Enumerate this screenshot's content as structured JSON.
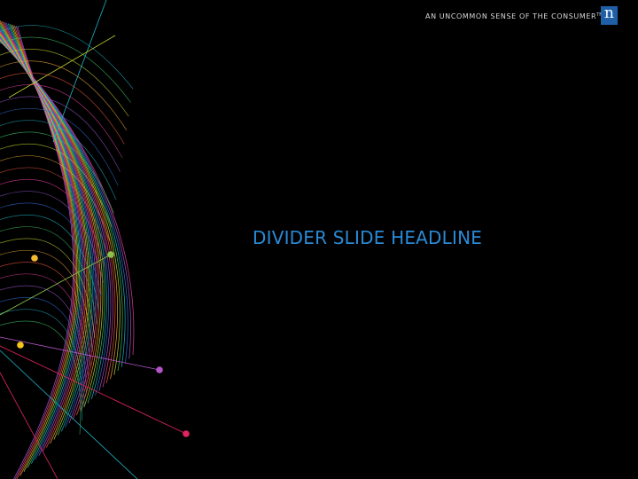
{
  "header": {
    "tagline": "AN UNCOMMON SENSE OF THE CONSUMER",
    "tagline_mark": "TM",
    "logo_letter": "n",
    "logo_color": "#1f5fa8"
  },
  "slide": {
    "headline": "DIVIDER SLIDE HEADLINE",
    "headline_color": "#2a8ad6",
    "background": "#000000"
  },
  "art": {
    "line_colors": [
      "#e63fa0",
      "#9b59d0",
      "#2f6fd6",
      "#1fb6c9",
      "#3fc36a",
      "#c8d630",
      "#f2a93b",
      "#ef5a3c"
    ],
    "dot_colors": [
      "#f5b82e",
      "#8bc34a",
      "#f5c518",
      "#b455c8",
      "#e0245e"
    ]
  }
}
